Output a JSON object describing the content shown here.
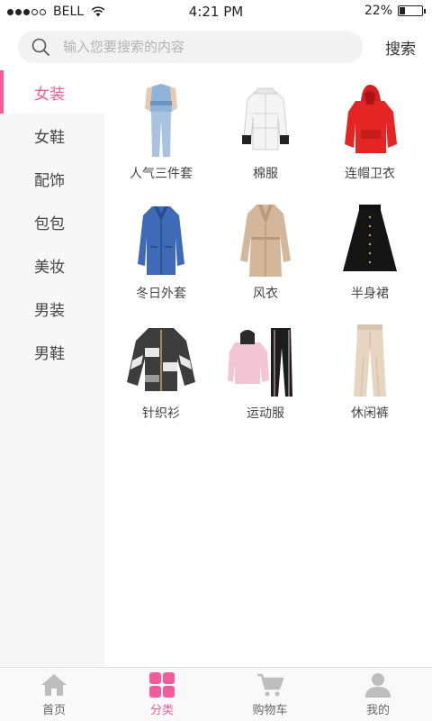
{
  "status": {
    "carrier": "BELL",
    "time": "4:21 PM",
    "battery": "22%",
    "battery_level": 0.22
  },
  "search": {
    "placeholder": "输入您要搜索的内容",
    "button_label": "搜索"
  },
  "sidebar": {
    "items": [
      {
        "label": "女装",
        "active": true
      },
      {
        "label": "女鞋"
      },
      {
        "label": "配饰"
      },
      {
        "label": "包包"
      },
      {
        "label": "美妆"
      },
      {
        "label": "男装"
      },
      {
        "label": "男鞋"
      }
    ]
  },
  "products": [
    {
      "label": "人气三件套",
      "icon": "three-piece-set-image"
    },
    {
      "label": "棉服",
      "icon": "padded-jacket-image"
    },
    {
      "label": "连帽卫衣",
      "icon": "hoodie-image"
    },
    {
      "label": "冬日外套",
      "icon": "winter-coat-image"
    },
    {
      "label": "风衣",
      "icon": "trench-coat-image"
    },
    {
      "label": "半身裙",
      "icon": "skirt-image"
    },
    {
      "label": "针织衫",
      "icon": "knit-cardigan-image"
    },
    {
      "label": "运动服",
      "icon": "tracksuit-image"
    },
    {
      "label": "休闲裤",
      "icon": "casual-pants-image"
    }
  ],
  "tabbar": {
    "items": [
      {
        "label": "首页",
        "icon": "home-icon"
      },
      {
        "label": "分类",
        "icon": "category-icon",
        "active": true
      },
      {
        "label": "购物车",
        "icon": "cart-icon"
      },
      {
        "label": "我的",
        "icon": "profile-icon"
      }
    ]
  },
  "colors": {
    "accent": "#f25c9a",
    "sidebar_bg": "#f7f7f7",
    "search_bg": "#f2f2f2",
    "tab_inactive": "#bdbdbd"
  }
}
